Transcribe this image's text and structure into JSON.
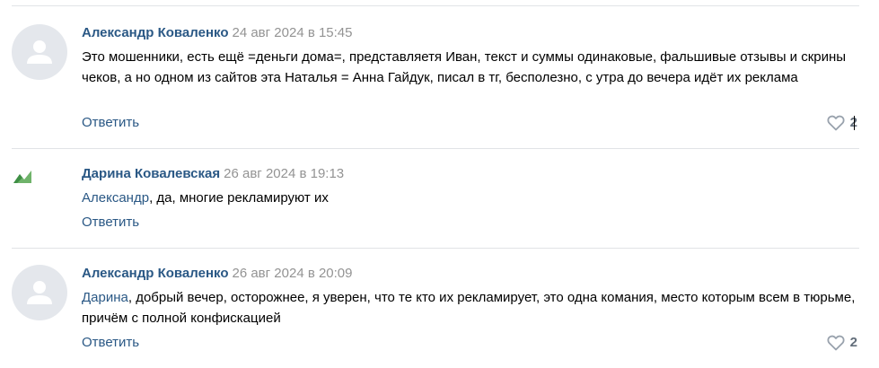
{
  "comments": [
    {
      "author": "Александр Коваленко",
      "date": "24 авг 2024 в 15:45",
      "mention": "",
      "text": "Это мошенники, есть ещё =деньги дома=, представляетя Иван, текст и суммы одинаковые, фальшивые отзывы и скрины чеков, а но одном из сайтов эта Наталья = Анна Гайдук, писал в тг, бесполезно, с утра до вечера идёт их реклама",
      "reply_label": "Ответить",
      "likes": "2"
    },
    {
      "author": "Дарина Ковалевская",
      "date": "26 авг 2024 в 19:13",
      "mention": "Александр",
      "text": ", да, многие рекламируют их",
      "reply_label": "Ответить",
      "likes": ""
    },
    {
      "author": "Александр Коваленко",
      "date": "26 авг 2024 в 20:09",
      "mention": "Дарина",
      "text": ", добрый вечер, осторожнее, я уверен, что те кто их рекламирует, это одна комания, место которым всем в тюрьме, причём с полной конфискацией",
      "reply_label": "Ответить",
      "likes": "2"
    }
  ],
  "icons": {
    "avatar_placeholder": "default-user-avatar-icon",
    "like": "heart-outline-icon",
    "broken_image": "broken-image-icon"
  },
  "colors": {
    "link": "#2a5885",
    "meta": "#939393",
    "divider": "#e1e3e6",
    "avatar_bg": "#e4e7ec"
  }
}
